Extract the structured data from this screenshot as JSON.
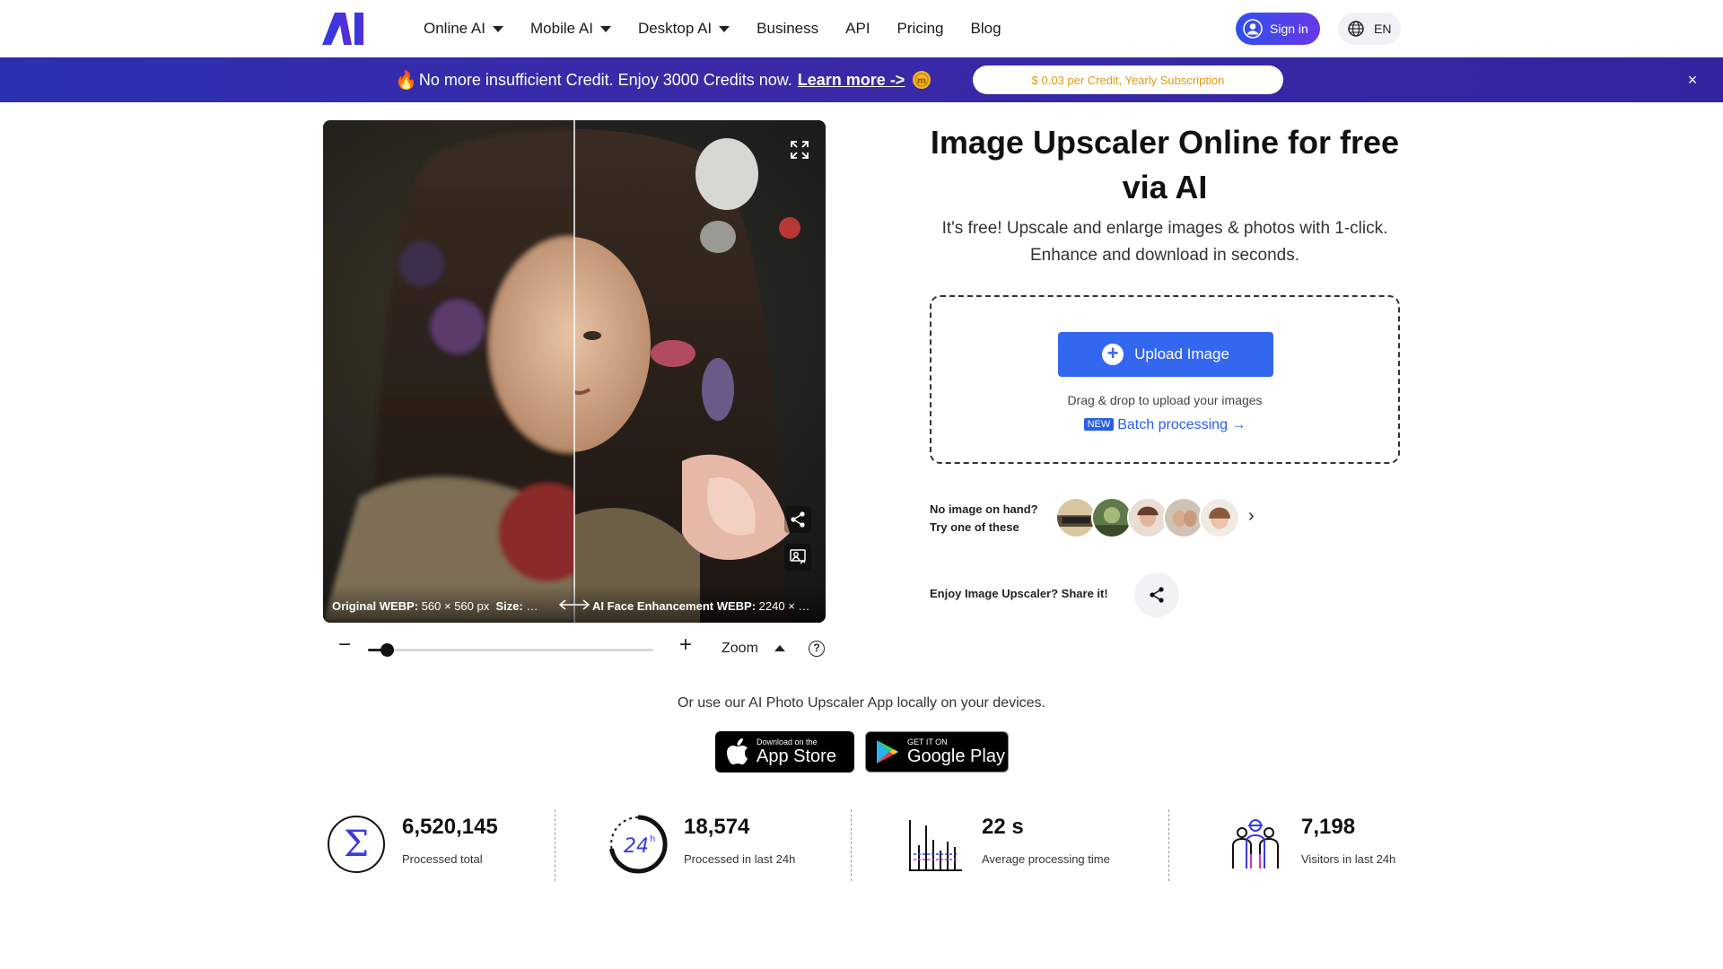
{
  "header": {
    "logo_alt": "AI",
    "nav": [
      {
        "label": "Online AI",
        "has_dropdown": true
      },
      {
        "label": "Mobile AI",
        "has_dropdown": true
      },
      {
        "label": "Desktop AI",
        "has_dropdown": true
      },
      {
        "label": "Business",
        "has_dropdown": false
      },
      {
        "label": "API",
        "has_dropdown": false
      },
      {
        "label": "Pricing",
        "has_dropdown": false
      },
      {
        "label": "Blog",
        "has_dropdown": false
      }
    ],
    "sign_in": "Sign in",
    "language": "EN"
  },
  "banner": {
    "text": "No more insufficient Credit. Enjoy 3000 Credits now.",
    "link": "Learn more ->",
    "pill": "$ 0.03 per Credit, Yearly Subscription",
    "close": "×"
  },
  "compare": {
    "left_label": "Original WEBP:",
    "left_detail": "560 × 560 px",
    "left_size_label": "Size:",
    "left_size_value": "…",
    "right_label": "AI Face Enhancement WEBP:",
    "right_detail": "2240 × …",
    "divider_position": 0.5
  },
  "zoom": {
    "minus": "−",
    "plus": "+",
    "label": "Zoom",
    "help": "?",
    "level": 0.05
  },
  "hero": {
    "title": "Image Upscaler Online for free via AI",
    "subtitle": "It's free! Upscale and enlarge images & photos with 1-click. Enhance and download in seconds."
  },
  "upload": {
    "button": "Upload Image",
    "drag_text": "Drag & drop to upload your images",
    "new_badge": "NEW",
    "batch": "Batch processing →"
  },
  "samples": {
    "line1": "No image on hand?",
    "line2": "Try one of these",
    "next": "›"
  },
  "share": {
    "text": "Enjoy Image Upscaler? Share it!"
  },
  "apps": {
    "text": "Or use our AI Photo Upscaler App locally on your devices.",
    "appstore_small": "Download on the",
    "appstore_big": "App Store",
    "gplay_small": "GET IT ON",
    "gplay_big": "Google Play"
  },
  "stats": [
    {
      "value": "6,520,145",
      "label": "Processed total",
      "icon": "sigma-icon"
    },
    {
      "value": "18,574",
      "label": "Processed in last 24h",
      "icon": "clock-24h-icon"
    },
    {
      "value": "22 s",
      "label": "Average processing time",
      "icon": "bar-chart-icon"
    },
    {
      "value": "7,198",
      "label": "Visitors in last 24h",
      "icon": "visitors-icon"
    }
  ],
  "colors": {
    "accent": "#3367f0",
    "banner": "#2a2fb0",
    "pill_text": "#e09a12"
  }
}
